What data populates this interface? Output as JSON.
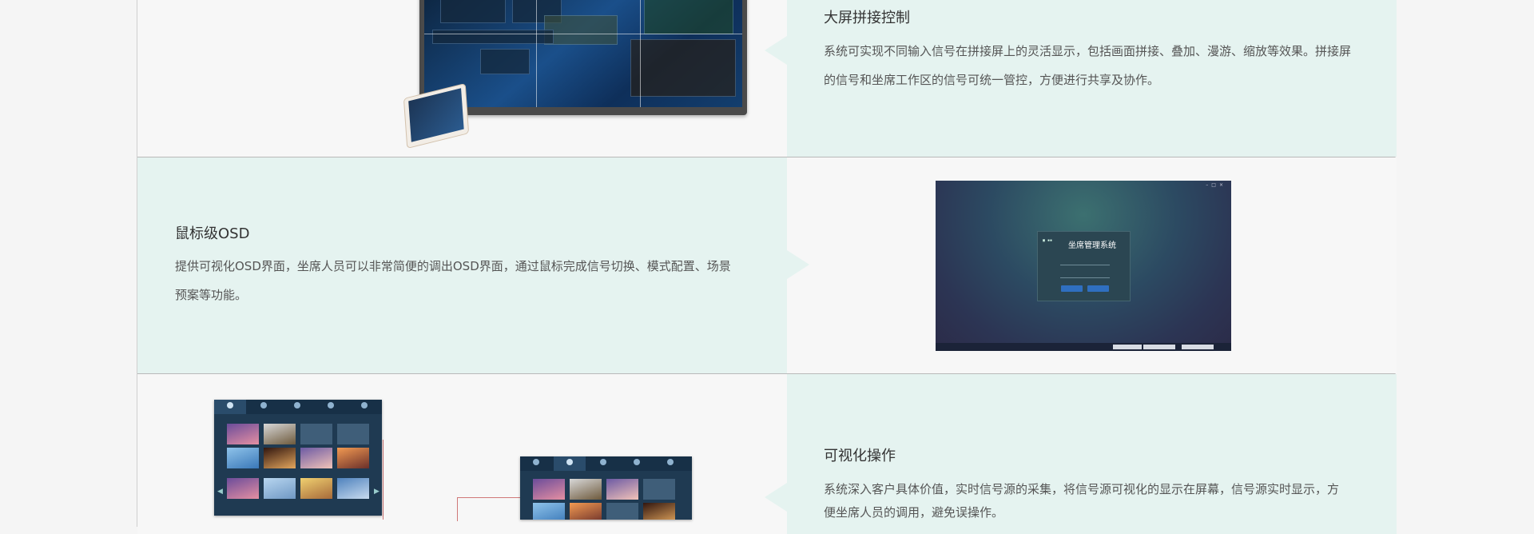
{
  "sections": [
    {
      "title": "大屏拼接控制",
      "lines": [
        "系统可实现不同输入信号在拼接屏上的灵活显示，包括画面拼接、叠加、漫游、缩放等效果。拼接屏",
        "的信号和坐席工作区的信号可统一管控，方便进行共享及协作。"
      ]
    },
    {
      "title": "鼠标级OSD",
      "lines": [
        "提供可视化OSD界面，坐席人员可以非常简便的调出OSD界面，通过鼠标完成信号切换、模式配置、场景",
        "预案等功能。"
      ],
      "screenshot": {
        "login_title": "坐席管理系统"
      }
    },
    {
      "title": "可视化操作",
      "lines": [
        "系统深入客户具体价值，实时信号源的采集，将信号源可视化的显示在屏幕，信号源实时显示，方",
        "便坐席人员的调用，避免误操作。"
      ]
    }
  ],
  "colors": {
    "teal_background": "#e5f3f0",
    "plain_background": "#f7f7f7",
    "divider": "#b9b9b9"
  },
  "icons": [
    "video-wall-illustration",
    "tablet-illustration",
    "login-screenshot",
    "ui-panel-illustration"
  ]
}
